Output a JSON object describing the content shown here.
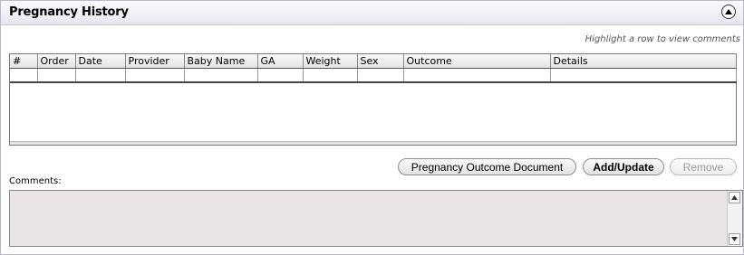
{
  "panel": {
    "title": "Pregnancy History",
    "hint": "Highlight a row to view comments"
  },
  "grid": {
    "columns": [
      "#",
      "Order",
      "Date",
      "Provider",
      "Baby Name",
      "GA",
      "Weight",
      "Sex",
      "Outcome",
      "Details"
    ]
  },
  "buttons": {
    "outcome_document": "Pregnancy Outcome Document",
    "add_update": "Add/Update",
    "remove": "Remove"
  },
  "comments": {
    "label": "Comments:",
    "value": ""
  },
  "icons": {
    "collapse": "collapse-up-icon",
    "scroll_up": "scroll-up-arrow-icon",
    "scroll_down": "scroll-down-arrow-icon"
  }
}
